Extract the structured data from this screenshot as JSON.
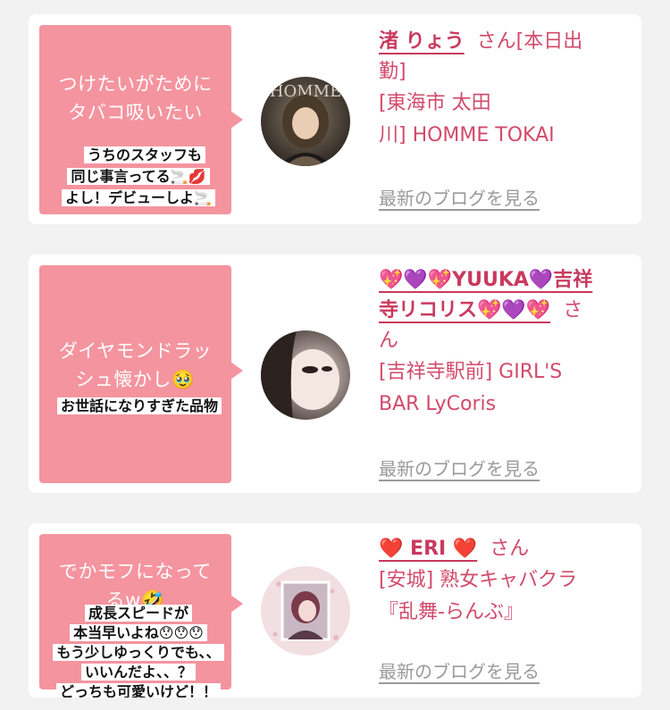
{
  "cards": [
    {
      "bubble_text": [
        "つけたいがために",
        "タバコ吸いたい"
      ],
      "sticker_lines": [
        "うちのスタッフも",
        "同じ事言ってる🚬💋",
        "よし！デビューしよ🚬"
      ],
      "name": "渚 りょう",
      "san": "さん[本日出",
      "name_cont": "勤]",
      "location": [
        "[東海市 太田",
        "川] HOMME TOKAI"
      ],
      "blog_link": "最新のブログを見る"
    },
    {
      "bubble_text": [
        "ダイヤモンドラッ",
        "シュ懐かし🥹"
      ],
      "sticker_lines": [
        "お世話になりすぎた品物"
      ],
      "name": "💖💜💖YUUKA💜吉祥",
      "name_cont": "寺リコリス💖💜💖",
      "san": "さ",
      "san_cont": "ん",
      "location": [
        "[吉祥寺駅前] GIRL'S",
        "BAR LyCoris"
      ],
      "blog_link": "最新のブログを見る"
    },
    {
      "bubble_text": [
        "でかモフになって",
        "るw🤣"
      ],
      "sticker_lines": [
        "成長スピードが",
        "本当早いよね😯😯😯",
        "もう少しゆっくりでも、、",
        "いいんだよ、、？",
        "どっちも可愛いけど！！"
      ],
      "name": "❤️ ERI ❤️",
      "san": "さん",
      "location": [
        "[安城] 熟女キャバクラ",
        "『乱舞-らんぶ』"
      ],
      "blog_link": "最新のブログを見る"
    }
  ],
  "colors": {
    "bubble": "#f4949f",
    "name": "#c93a5f",
    "link_gray": "#9a9a9a"
  }
}
